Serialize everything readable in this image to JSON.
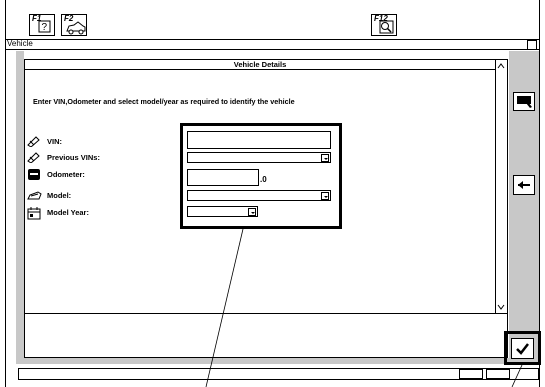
{
  "toolbar": {
    "f1_label": "F1",
    "f2_label": "F2",
    "f12_label": "F12"
  },
  "window": {
    "title": "Vehicle"
  },
  "panel": {
    "title": "Vehicle Details",
    "instruction": "Enter VIN,Odometer and select model/year as required to identify the vehicle"
  },
  "form": {
    "vin_label": "VIN:",
    "prev_vins_label": "Previous VINs:",
    "odometer_label": "Odometer:",
    "odometer_suffix": ".0",
    "model_label": "Model:",
    "model_year_label": "Model Year:"
  },
  "icons": [
    "help-icon",
    "vehicle-icon",
    "search-icon",
    "pencil-icon",
    "odometer-icon",
    "car-icon",
    "calendar-icon",
    "edit-icon",
    "back-arrow-icon",
    "checkmark-icon"
  ]
}
